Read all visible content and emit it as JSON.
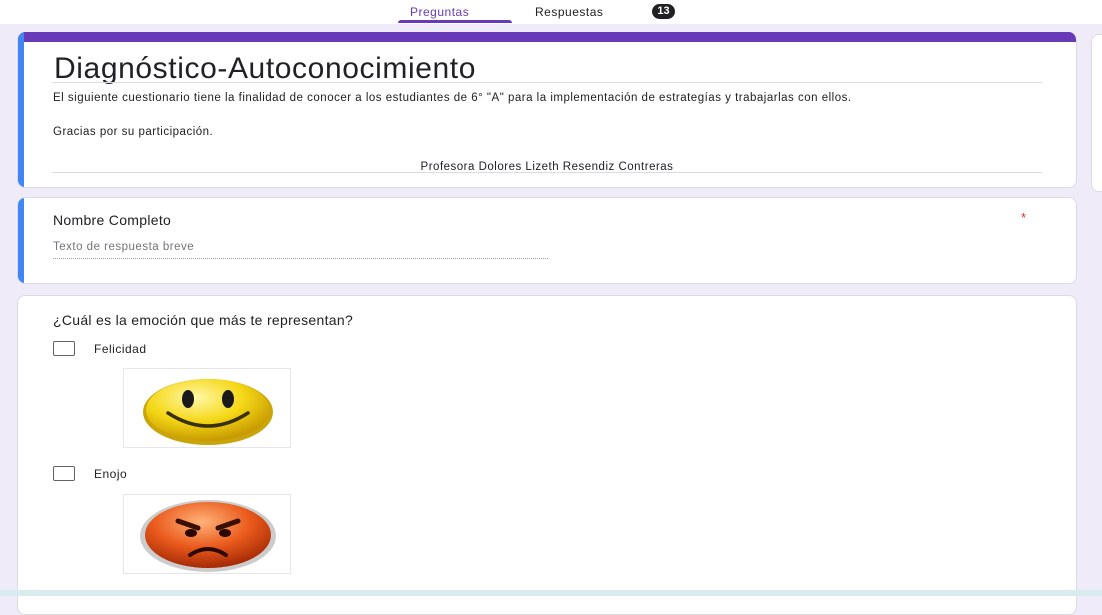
{
  "tabs": {
    "questions": "Preguntas",
    "responses": "Respuestas",
    "responses_count": "13"
  },
  "form": {
    "title": "Diagnóstico-Autoconocimiento",
    "description": "El siguiente cuestionario tiene la finalidad de conocer a los estudiantes de 6° \"A\" para la implementación de estrategías y trabajarlas con ellos.",
    "thanks": "Gracias por su participación.",
    "author": "Profesora Dolores Lizeth Resendiz Contreras"
  },
  "question1": {
    "title": "Nombre Completo",
    "required_mark": "*",
    "placeholder": "Texto de respuesta breve"
  },
  "question2": {
    "title": "¿Cuál es la emoción que más te representan?",
    "options": [
      {
        "label": "Felicidad",
        "image": "smiley-face-icon"
      },
      {
        "label": "Enojo",
        "image": "angry-face-icon"
      }
    ]
  },
  "colors": {
    "accent": "#673ab7",
    "focus_bar": "#4285f4",
    "required": "#d93025",
    "background": "#f0ebf8"
  }
}
